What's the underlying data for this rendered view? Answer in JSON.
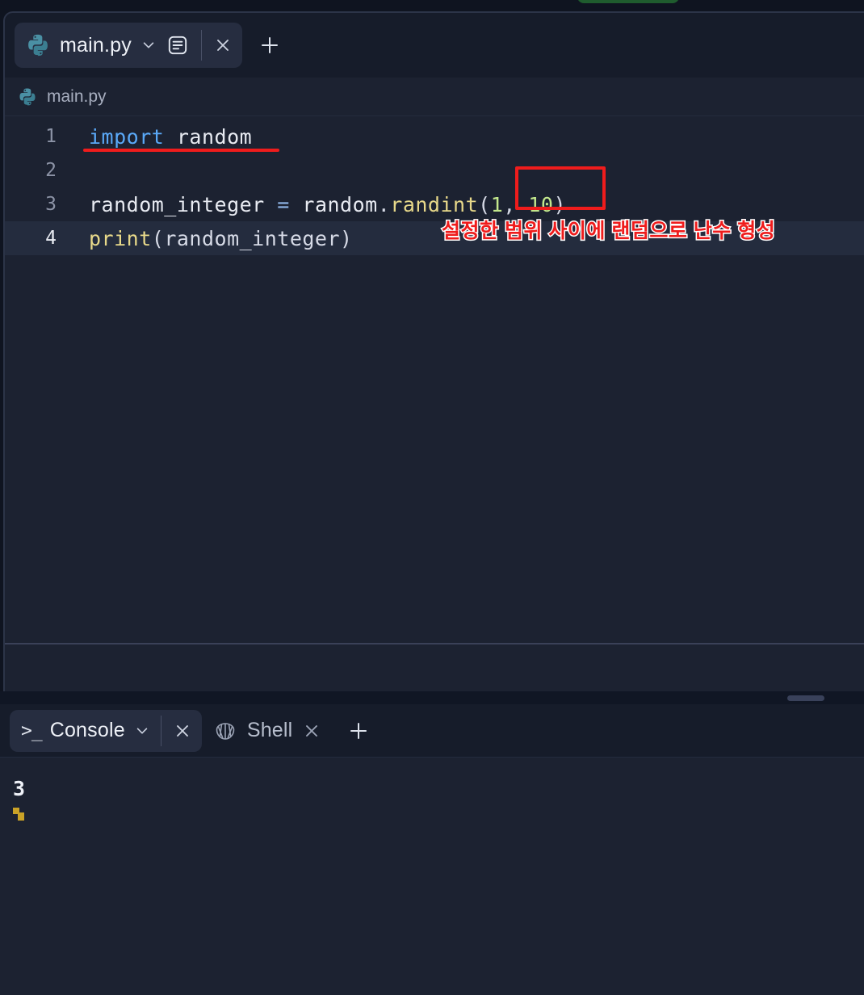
{
  "top_fragment": {
    "name": "green-run-button-fragment",
    "color": "#1f5c2e"
  },
  "editor": {
    "tab": {
      "icon": "python-icon",
      "label": "main.py",
      "dropdown_icon": "chevron-down-icon",
      "pane_icon": "pane-options-icon",
      "close_icon": "close-icon"
    },
    "new_tab_icon": "plus-icon",
    "breadcrumb": {
      "icon": "python-icon",
      "label": "main.py"
    },
    "lines": [
      {
        "number": "1",
        "tokens": [
          {
            "t": "import",
            "c": "tok-kw"
          },
          {
            "t": " random",
            "c": "tok-plain"
          }
        ]
      },
      {
        "number": "2",
        "tokens": []
      },
      {
        "number": "3",
        "tokens": [
          {
            "t": "random_integer ",
            "c": "tok-plain"
          },
          {
            "t": "=",
            "c": "tok-op"
          },
          {
            "t": " random",
            "c": "tok-plain"
          },
          {
            "t": ".",
            "c": "tok-punc"
          },
          {
            "t": "randint",
            "c": "tok-fn"
          },
          {
            "t": "(",
            "c": "tok-punc"
          },
          {
            "t": "1",
            "c": "tok-num"
          },
          {
            "t": ", ",
            "c": "tok-punc"
          },
          {
            "t": "10",
            "c": "tok-num"
          },
          {
            "t": ")",
            "c": "tok-punc"
          }
        ]
      },
      {
        "number": "4",
        "active": true,
        "tokens": [
          {
            "t": "print",
            "c": "tok-fn"
          },
          {
            "t": "(random_integer)",
            "c": "tok-punc"
          }
        ]
      }
    ],
    "annotations": {
      "underline_color": "#ef1c1c",
      "box_color": "#ef1c1c",
      "note_text": "설정한 범위 사이에 랜덤으로 난수 형성",
      "note_color": "#ef1c1c",
      "note_stroke_color": "#ffffff"
    }
  },
  "splitter": {
    "handle_color": "#39415a"
  },
  "console": {
    "tabs": [
      {
        "icon": "terminal-prompt-icon",
        "label": "Console",
        "dropdown_icon": "chevron-down-icon",
        "close_icon": "close-icon",
        "active": true
      },
      {
        "icon": "shell-icon",
        "label": "Shell",
        "close_icon": "close-icon",
        "active": false
      }
    ],
    "new_tab_icon": "plus-icon",
    "output": [
      "3"
    ],
    "cursor_color": "#c9a227"
  }
}
